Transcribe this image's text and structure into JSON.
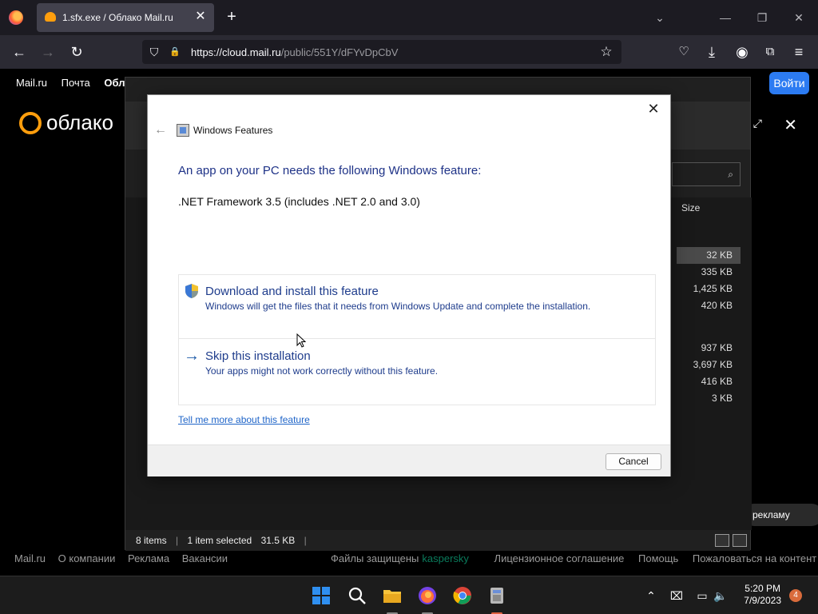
{
  "browser": {
    "tab_title": "1.sfx.exe / Облако Mail.ru",
    "url_host": "https://cloud.mail.ru",
    "url_path": "/public/551Y/dFYvDpCbV",
    "tab_close": "✕",
    "new_tab": "+",
    "list_tabs": "⌄",
    "minimize": "—",
    "restore": "❐",
    "close": "✕",
    "back": "←",
    "forward": "→",
    "reload": "↻",
    "bookmark": "☆",
    "shield": "⛉",
    "lock": "🔒",
    "pocket": "♡",
    "download": "⤓",
    "account": "◉",
    "extensions": "⧉",
    "menu": "≡"
  },
  "page": {
    "menu": [
      "Mail.ru",
      "Почта",
      "Обла"
    ],
    "login_label": "Войти",
    "logo_text": "облако",
    "expand": "⤢",
    "close": "✕",
    "report_label": "рекламу",
    "footer_left": [
      "Mail.ru",
      "О компании",
      "Реклама",
      "Вакансии"
    ],
    "footer_files": "Файлы защищены",
    "footer_kaspersky": "kaspersky",
    "footer_right": [
      "Лицензионное соглашение",
      "Помощь",
      "Пожаловаться на контент"
    ]
  },
  "explorer": {
    "column_size": "Size",
    "search_icon": "⌕",
    "sizes_group1": [
      "32 KB",
      "335 KB",
      "1,425 KB",
      "420 KB"
    ],
    "sizes_group2": [
      "937 KB",
      "3,697 KB",
      "416 KB",
      "3 KB"
    ],
    "status_items": "8 items",
    "status_selected": "1 item selected",
    "status_size": "31.5 KB"
  },
  "dialog": {
    "title": "Windows Features",
    "close": "✕",
    "back": "←",
    "heading": "An app on your PC needs the following Windows feature:",
    "feature": ".NET Framework 3.5 (includes .NET 2.0 and 3.0)",
    "option1_title": "Download and install this feature",
    "option1_desc": "Windows will get the files that it needs from Windows Update and complete the installation.",
    "option2_title": "Skip this installation",
    "option2_desc": "Your apps might not work correctly without this feature.",
    "option2_arrow": "→",
    "more_link": "Tell me more about this feature",
    "cancel_label": "Cancel"
  },
  "taskbar": {
    "time": "5:20 PM",
    "date": "7/9/2023",
    "notifications": "4",
    "chevron": "⌃",
    "tray_network": "⌧",
    "tray_display": "▭",
    "tray_volume": "🔈"
  },
  "colors": {
    "dialog_heading": "#1e3287",
    "link": "#1e64c8",
    "login_button": "#2c7bf2",
    "brand_orange": "#ff9e0d"
  }
}
